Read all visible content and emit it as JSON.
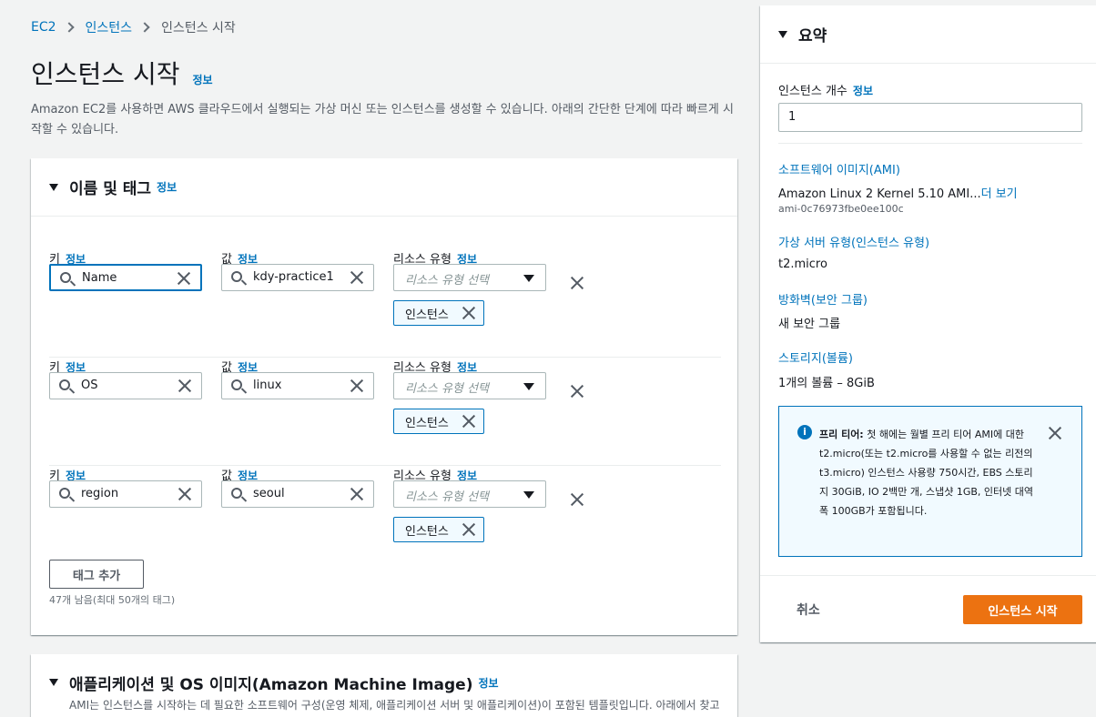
{
  "breadcrumb": {
    "root": "EC2",
    "parent": "인스턴스",
    "current": "인스턴스 시작"
  },
  "page": {
    "title": "인스턴스 시작",
    "info": "정보",
    "description": "Amazon EC2를 사용하면 AWS 클라우드에서 실행되는 가상 머신 또는 인스턴스를 생성할 수 있습니다. 아래의 간단한 단계에 따라 빠르게 시작할 수 있습니다."
  },
  "tags_panel": {
    "title": "이름 및 태그",
    "info": "정보",
    "key_label": "키",
    "value_label": "값",
    "resource_label": "리소스 유형",
    "resource_placeholder": "리소스 유형 선택",
    "rows": [
      {
        "key": "Name",
        "value": "kdy-practice1",
        "token": "인스턴스"
      },
      {
        "key": "OS",
        "value": "linux",
        "token": "인스턴스"
      },
      {
        "key": "region",
        "value": "seoul",
        "token": "인스턴스"
      }
    ],
    "add_tag": "태그 추가",
    "remaining": "47개 남음(최대 50개의 태그)"
  },
  "ami_panel": {
    "title": "애플리케이션 및 OS 이미지(Amazon Machine Image)",
    "info": "정보",
    "description": "AMI는 인스턴스를 시작하는 데 필요한 소프트웨어 구성(운영 체제, 애플리케이션 서버 및 애플리케이션)이 포함된 템플릿입니다. 아래에서 찾고 있는 항목이 보이지 않으면 AMI를 검색하거나 찾아보십시오."
  },
  "summary": {
    "title": "요약",
    "instance_count_label": "인스턴스 개수",
    "info": "정보",
    "instance_count": "1",
    "ami_label": "소프트웨어 이미지(AMI)",
    "ami_name": "Amazon Linux 2 Kernel 5.10 AMI...",
    "ami_more": "더 보기",
    "ami_id": "ami-0c76973fbe0ee100c",
    "type_label": "가상 서버 유형(인스턴스 유형)",
    "type_value": "t2.micro",
    "firewall_label": "방화벽(보안 그룹)",
    "firewall_value": "새 보안 그룹",
    "storage_label": "스토리지(볼륨)",
    "storage_value": "1개의 볼륨 – 8GiB",
    "alert_title": "프리 티어:",
    "alert_text": " 첫 해에는 월별 프리 티어 AMI에 대한 t2.micro(또는 t2.micro를 사용할 수 없는 리전의 t3.micro) 인스턴스 사용량 750시간, EBS 스토리지 30GiB, IO 2백만 개, 스냅샷 1GB, 인터넷 대역폭 100GB가 포함됩니다.",
    "cancel": "취소",
    "launch": "인스턴스 시작"
  },
  "colors": {
    "accent": "#0073bb",
    "primary_button": "#ec7211"
  }
}
